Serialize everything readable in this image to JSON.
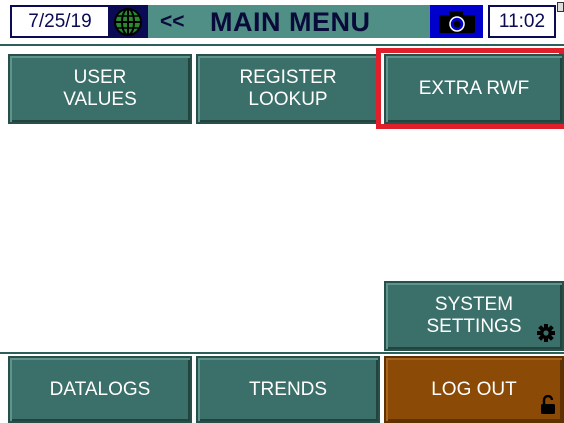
{
  "header": {
    "date": "7/25/19",
    "back_label": "<<",
    "title": "MAIN MENU",
    "time": "11:02",
    "globe_icon": "globe-icon",
    "camera_icon": "camera-icon"
  },
  "buttons": {
    "user_values": "USER\nVALUES",
    "register_lookup": "REGISTER\nLOOKUP",
    "extra_rwf": "EXTRA RWF",
    "system_settings": "SYSTEM\nSETTINGS",
    "datalogs": "DATALOGS",
    "trends": "TRENDS",
    "log_out": "LOG OUT"
  },
  "colors": {
    "button_teal": "#3b6f69",
    "header_teal": "#4f8f86",
    "logout_brown": "#8b4a05",
    "selection_red": "#e01f2b",
    "navy": "#0a0a55"
  },
  "icons": {
    "settings": "gear-icon",
    "logout": "padlock-icon"
  }
}
